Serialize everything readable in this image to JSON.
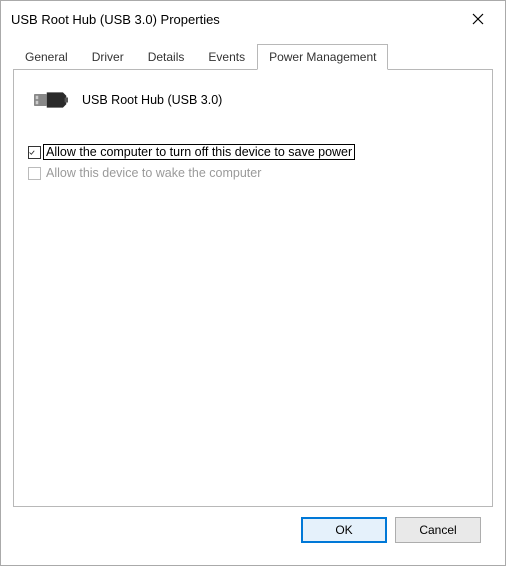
{
  "window": {
    "title": "USB Root Hub (USB 3.0) Properties"
  },
  "tabs": {
    "general": "General",
    "driver": "Driver",
    "details": "Details",
    "events": "Events",
    "power_management": "Power Management"
  },
  "panel": {
    "device_name": "USB Root Hub (USB 3.0)",
    "checkbox1_label": "Allow the computer to turn off this device to save power",
    "checkbox2_label": "Allow this device to wake the computer"
  },
  "buttons": {
    "ok": "OK",
    "cancel": "Cancel"
  }
}
